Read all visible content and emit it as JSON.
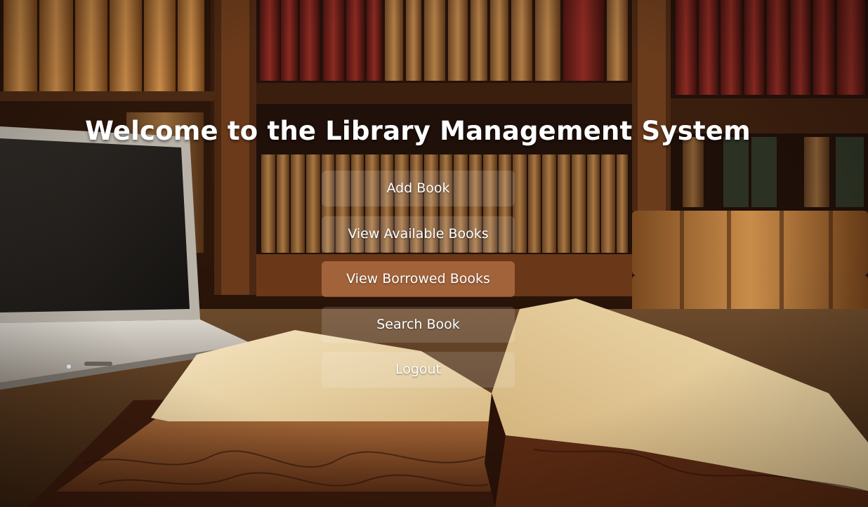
{
  "page": {
    "title": "Welcome to the Library Management System"
  },
  "menu": {
    "items": [
      {
        "label": "Add Book",
        "active": false
      },
      {
        "label": "View Available Books",
        "active": false
      },
      {
        "label": "View Borrowed Books",
        "active": true
      },
      {
        "label": "Search Book",
        "active": false
      },
      {
        "label": "Logout",
        "active": false
      }
    ]
  },
  "colors": {
    "text": "#ffffff",
    "button_bg": "rgba(255,255,255,0.14)",
    "button_hover_bg": "rgba(240,160,110,0.42)"
  },
  "background": {
    "subject": "library bookshelves with open book and laptop"
  }
}
